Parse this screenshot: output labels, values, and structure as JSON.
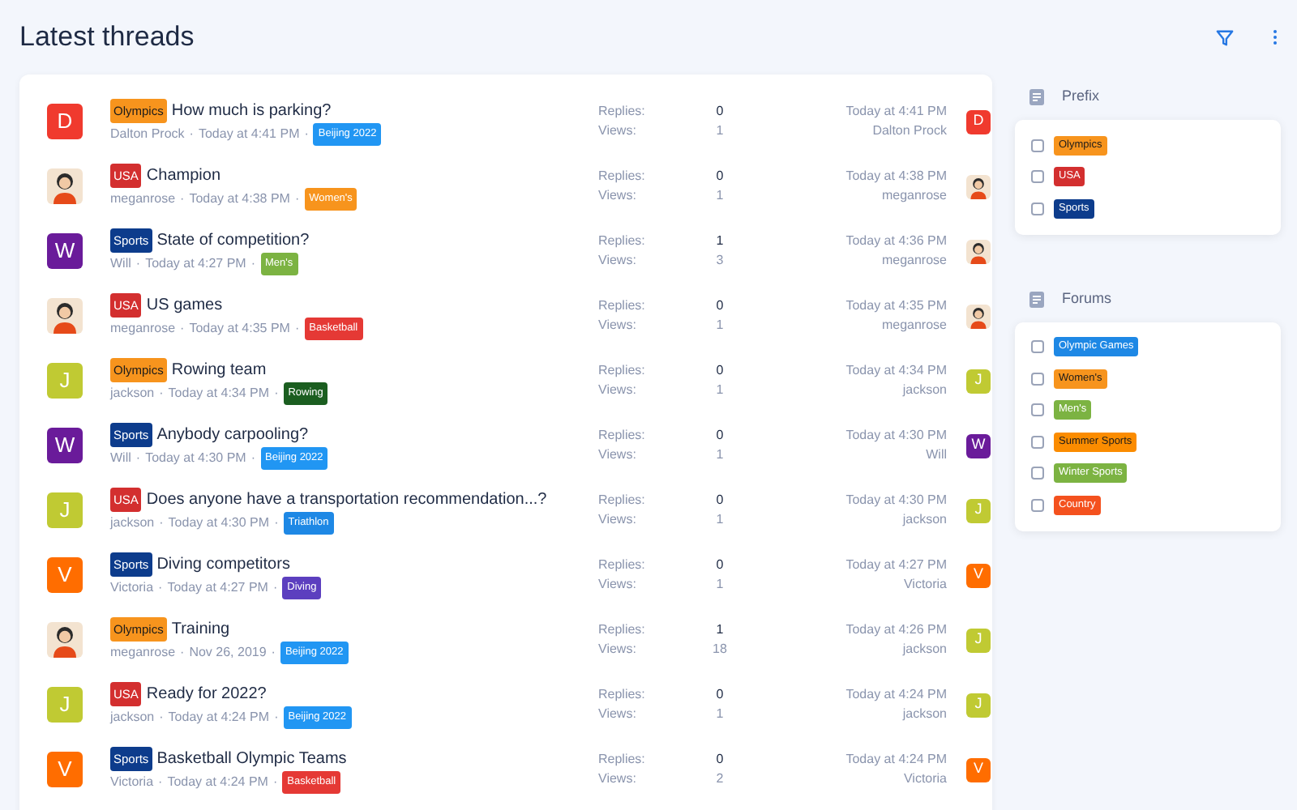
{
  "header": {
    "title": "Latest threads"
  },
  "threads": [
    {
      "avatar": {
        "kind": "letter",
        "letter": "D",
        "color": "#f03a2e"
      },
      "prefix": {
        "text": "Olympics",
        "color": "#f7941d"
      },
      "title": "How much is parking?",
      "author": "Dalton Prock",
      "seps": [
        "·",
        "·"
      ],
      "time": "Today at 4:41 PM",
      "forum": {
        "text": "Beijing 2022",
        "color": "#2196f3"
      },
      "replies_label": "Replies:",
      "replies": "0",
      "views_label": "Views:",
      "views": "1",
      "last_time": "Today at 4:41 PM",
      "last_user": "Dalton Prock",
      "last_avatar": {
        "kind": "letter",
        "letter": "D",
        "color": "#f03a2e"
      }
    },
    {
      "avatar": {
        "kind": "person"
      },
      "prefix": {
        "text": "USA",
        "color": "#d32f2f"
      },
      "title": "Champion",
      "author": "meganrose",
      "seps": [
        "·",
        "·"
      ],
      "time": "Today at 4:38 PM",
      "forum": {
        "text": "Women's",
        "color": "#f7941d"
      },
      "replies_label": "Replies:",
      "replies": "0",
      "views_label": "Views:",
      "views": "1",
      "last_time": "Today at 4:38 PM",
      "last_user": "meganrose",
      "last_avatar": {
        "kind": "person"
      }
    },
    {
      "avatar": {
        "kind": "letter",
        "letter": "W",
        "color": "#6a1b9a"
      },
      "prefix": {
        "text": "Sports",
        "color": "#0d3c8c"
      },
      "title": "State of competition?",
      "author": "Will",
      "seps": [
        "·",
        "·"
      ],
      "time": "Today at 4:27 PM",
      "forum": {
        "text": "Men's",
        "color": "#7cb342"
      },
      "replies_label": "Replies:",
      "replies": "1",
      "views_label": "Views:",
      "views": "3",
      "last_time": "Today at 4:36 PM",
      "last_user": "meganrose",
      "last_avatar": {
        "kind": "person"
      }
    },
    {
      "avatar": {
        "kind": "person"
      },
      "prefix": {
        "text": "USA",
        "color": "#d32f2f"
      },
      "title": "US games",
      "author": "meganrose",
      "seps": [
        "·",
        "·"
      ],
      "time": "Today at 4:35 PM",
      "forum": {
        "text": "Basketball",
        "color": "#e53935"
      },
      "replies_label": "Replies:",
      "replies": "0",
      "views_label": "Views:",
      "views": "1",
      "last_time": "Today at 4:35 PM",
      "last_user": "meganrose",
      "last_avatar": {
        "kind": "person"
      }
    },
    {
      "avatar": {
        "kind": "letter",
        "letter": "J",
        "color": "#c0ca33"
      },
      "prefix": {
        "text": "Olympics",
        "color": "#f7941d"
      },
      "title": "Rowing team",
      "author": "jackson",
      "seps": [
        "·",
        "·"
      ],
      "time": "Today at 4:34 PM",
      "forum": {
        "text": "Rowing",
        "color": "#1b5e20"
      },
      "replies_label": "Replies:",
      "replies": "0",
      "views_label": "Views:",
      "views": "1",
      "last_time": "Today at 4:34 PM",
      "last_user": "jackson",
      "last_avatar": {
        "kind": "letter",
        "letter": "J",
        "color": "#c0ca33"
      }
    },
    {
      "avatar": {
        "kind": "letter",
        "letter": "W",
        "color": "#6a1b9a"
      },
      "prefix": {
        "text": "Sports",
        "color": "#0d3c8c"
      },
      "title": "Anybody carpooling?",
      "author": "Will",
      "seps": [
        "·",
        "·"
      ],
      "time": "Today at 4:30 PM",
      "forum": {
        "text": "Beijing 2022",
        "color": "#2196f3"
      },
      "replies_label": "Replies:",
      "replies": "0",
      "views_label": "Views:",
      "views": "1",
      "last_time": "Today at 4:30 PM",
      "last_user": "Will",
      "last_avatar": {
        "kind": "letter",
        "letter": "W",
        "color": "#6a1b9a"
      }
    },
    {
      "avatar": {
        "kind": "letter",
        "letter": "J",
        "color": "#c0ca33"
      },
      "prefix": {
        "text": "USA",
        "color": "#d32f2f"
      },
      "title": "Does anyone have a transportation recommendation...?",
      "author": "jackson",
      "seps": [
        "·",
        "·"
      ],
      "time": "Today at 4:30 PM",
      "forum": {
        "text": "Triathlon",
        "color": "#1e88e5"
      },
      "replies_label": "Replies:",
      "replies": "0",
      "views_label": "Views:",
      "views": "1",
      "last_time": "Today at 4:30 PM",
      "last_user": "jackson",
      "last_avatar": {
        "kind": "letter",
        "letter": "J",
        "color": "#c0ca33"
      }
    },
    {
      "avatar": {
        "kind": "letter",
        "letter": "V",
        "color": "#ff6d00"
      },
      "prefix": {
        "text": "Sports",
        "color": "#0d3c8c"
      },
      "title": "Diving competitors",
      "author": "Victoria",
      "seps": [
        "·",
        "·"
      ],
      "time": "Today at 4:27 PM",
      "forum": {
        "text": "Diving",
        "color": "#5c3fbf"
      },
      "replies_label": "Replies:",
      "replies": "0",
      "views_label": "Views:",
      "views": "1",
      "last_time": "Today at 4:27 PM",
      "last_user": "Victoria",
      "last_avatar": {
        "kind": "letter",
        "letter": "V",
        "color": "#ff6d00"
      }
    },
    {
      "avatar": {
        "kind": "person"
      },
      "prefix": {
        "text": "Olympics",
        "color": "#f7941d"
      },
      "title": "Training",
      "author": "meganrose",
      "seps": [
        "·",
        "·"
      ],
      "time": "Nov 26, 2019",
      "forum": {
        "text": "Beijing 2022",
        "color": "#2196f3"
      },
      "replies_label": "Replies:",
      "replies": "1",
      "views_label": "Views:",
      "views": "18",
      "last_time": "Today at 4:26 PM",
      "last_user": "jackson",
      "last_avatar": {
        "kind": "letter",
        "letter": "J",
        "color": "#c0ca33"
      }
    },
    {
      "avatar": {
        "kind": "letter",
        "letter": "J",
        "color": "#c0ca33"
      },
      "prefix": {
        "text": "USA",
        "color": "#d32f2f"
      },
      "title": "Ready for 2022?",
      "author": "jackson",
      "seps": [
        "·",
        "·"
      ],
      "time": "Today at 4:24 PM",
      "forum": {
        "text": "Beijing 2022",
        "color": "#2196f3"
      },
      "replies_label": "Replies:",
      "replies": "0",
      "views_label": "Views:",
      "views": "1",
      "last_time": "Today at 4:24 PM",
      "last_user": "jackson",
      "last_avatar": {
        "kind": "letter",
        "letter": "J",
        "color": "#c0ca33"
      }
    },
    {
      "avatar": {
        "kind": "letter",
        "letter": "V",
        "color": "#ff6d00"
      },
      "prefix": {
        "text": "Sports",
        "color": "#0d3c8c"
      },
      "title": "Basketball Olympic Teams",
      "author": "Victoria",
      "seps": [
        "·",
        "·"
      ],
      "time": "Today at 4:24 PM",
      "forum": {
        "text": "Basketball",
        "color": "#e53935"
      },
      "replies_label": "Replies:",
      "replies": "0",
      "views_label": "Views:",
      "views": "2",
      "last_time": "Today at 4:24 PM",
      "last_user": "Victoria",
      "last_avatar": {
        "kind": "letter",
        "letter": "V",
        "color": "#ff6d00"
      }
    }
  ],
  "filters": [
    {
      "title": "Prefix",
      "items": [
        {
          "label": "Olympics",
          "color": "#f7941d",
          "checked": false
        },
        {
          "label": "USA",
          "color": "#d32f2f",
          "checked": false
        },
        {
          "label": "Sports",
          "color": "#0d3c8c",
          "checked": false
        }
      ]
    },
    {
      "title": "Forums",
      "items": [
        {
          "label": "Olympic Games",
          "color": "#1e88e5",
          "checked": false
        },
        {
          "label": "Women's",
          "color": "#f7941d",
          "checked": false
        },
        {
          "label": "Men's",
          "color": "#7cb342",
          "checked": false
        },
        {
          "label": "Summer Sports",
          "color": "#fb8c00",
          "checked": false
        },
        {
          "label": "Winter Sports",
          "color": "#7cb342",
          "checked": false
        },
        {
          "label": "Country",
          "color": "#f4511e",
          "checked": false
        }
      ]
    }
  ]
}
